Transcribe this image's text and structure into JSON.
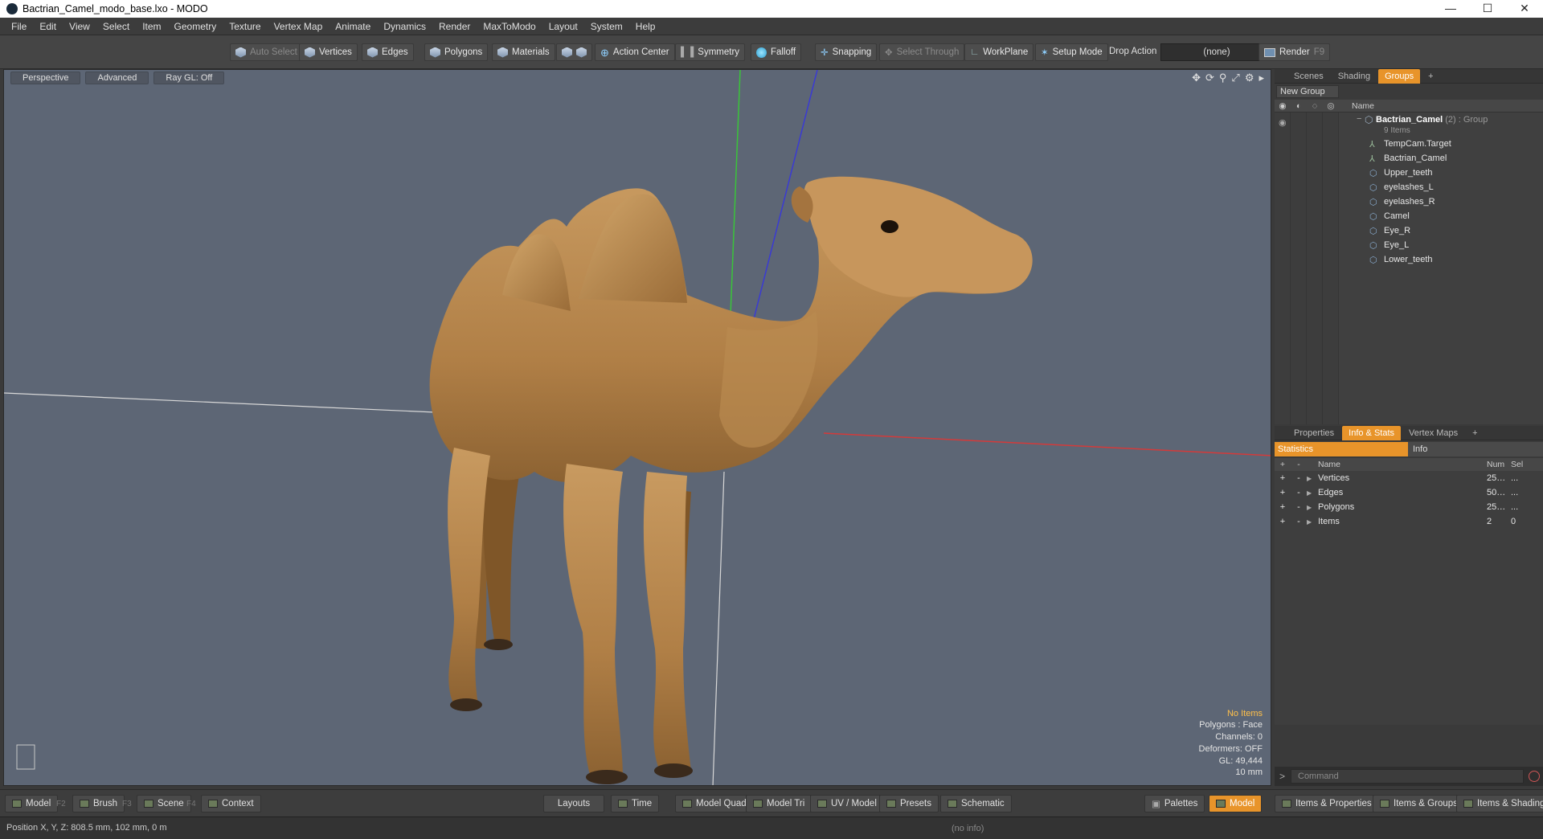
{
  "window": {
    "title": "Bactrian_Camel_modo_base.lxo - MODO",
    "controls": [
      "—",
      "☐",
      "✕"
    ]
  },
  "menu": [
    "File",
    "Edit",
    "View",
    "Select",
    "Item",
    "Geometry",
    "Texture",
    "Vertex Map",
    "Animate",
    "Dynamics",
    "Render",
    "MaxToModo",
    "Layout",
    "System",
    "Help"
  ],
  "toolbar": {
    "auto_select": "Auto Select",
    "vertices": "Vertices",
    "edges": "Edges",
    "polygons": "Polygons",
    "materials": "Materials",
    "action_center": "Action Center",
    "symmetry": "Symmetry",
    "falloff": "Falloff",
    "snapping": "Snapping",
    "select_through": "Select Through",
    "workplane": "WorkPlane",
    "setup_mode": "Setup Mode",
    "drop_action": "Drop Action",
    "drop_value": "(none)",
    "render": "Render",
    "render_key": "F9"
  },
  "viewport": {
    "tabs": [
      "Perspective",
      "Advanced",
      "Ray GL: Off"
    ],
    "info": {
      "no_items": "No Items",
      "polygons": "Polygons : Face",
      "channels": "Channels: 0",
      "deformers": "Deformers: OFF",
      "gl": "GL: 49,444",
      "scale": "10 mm"
    }
  },
  "scene_panel": {
    "tabs": [
      "Scenes",
      "Shading",
      "Groups",
      "+"
    ],
    "active_tab": "Groups",
    "new_group": "New Group",
    "col_name": "Name",
    "group": {
      "name": "Bactrian_Camel",
      "suffix": "(2) : Group",
      "count": "9 Items"
    },
    "items": [
      "TempCam.Target",
      "Bactrian_Camel",
      "Upper_teeth",
      "eyelashes_L",
      "eyelashes_R",
      "Camel",
      "Eye_R",
      "Eye_L",
      "Lower_teeth"
    ]
  },
  "props_panel": {
    "tabs": [
      "Properties",
      "Info & Stats",
      "Vertex Maps",
      "+"
    ],
    "active_tab": "Info & Stats",
    "sub_tabs": [
      "Statistics",
      "Info"
    ],
    "columns": {
      "name": "Name",
      "num": "Num",
      "sel": "Sel"
    },
    "rows": [
      {
        "name": "Vertices",
        "num": "25…",
        "sel": "..."
      },
      {
        "name": "Edges",
        "num": "50…",
        "sel": "..."
      },
      {
        "name": "Polygons",
        "num": "25…",
        "sel": "..."
      },
      {
        "name": "Items",
        "num": "2",
        "sel": "0"
      }
    ],
    "command_placeholder": "Command"
  },
  "bottom": {
    "left": [
      {
        "label": "Model",
        "key": "F2"
      },
      {
        "label": "Brush",
        "key": "F3"
      },
      {
        "label": "Scene",
        "key": "F4"
      },
      {
        "label": "Context",
        "key": ""
      }
    ],
    "center": [
      "Layouts",
      "Time",
      "Model Quad",
      "Model Tri",
      "UV / Model",
      "Presets",
      "Schematic"
    ],
    "right": [
      "Palettes",
      "Model",
      "Items & Properties",
      "Items & Groups",
      "Items & Shading"
    ]
  },
  "status": {
    "position": "Position X, Y, Z:  808.5 mm, 102 mm, 0 m",
    "info": "(no info)"
  },
  "colors": {
    "accent": "#e8942a",
    "viewport_bg": "#5d6675",
    "axis_x": "#d43a3a",
    "axis_y": "#3ac43a",
    "axis_z": "#3a3ad4"
  }
}
